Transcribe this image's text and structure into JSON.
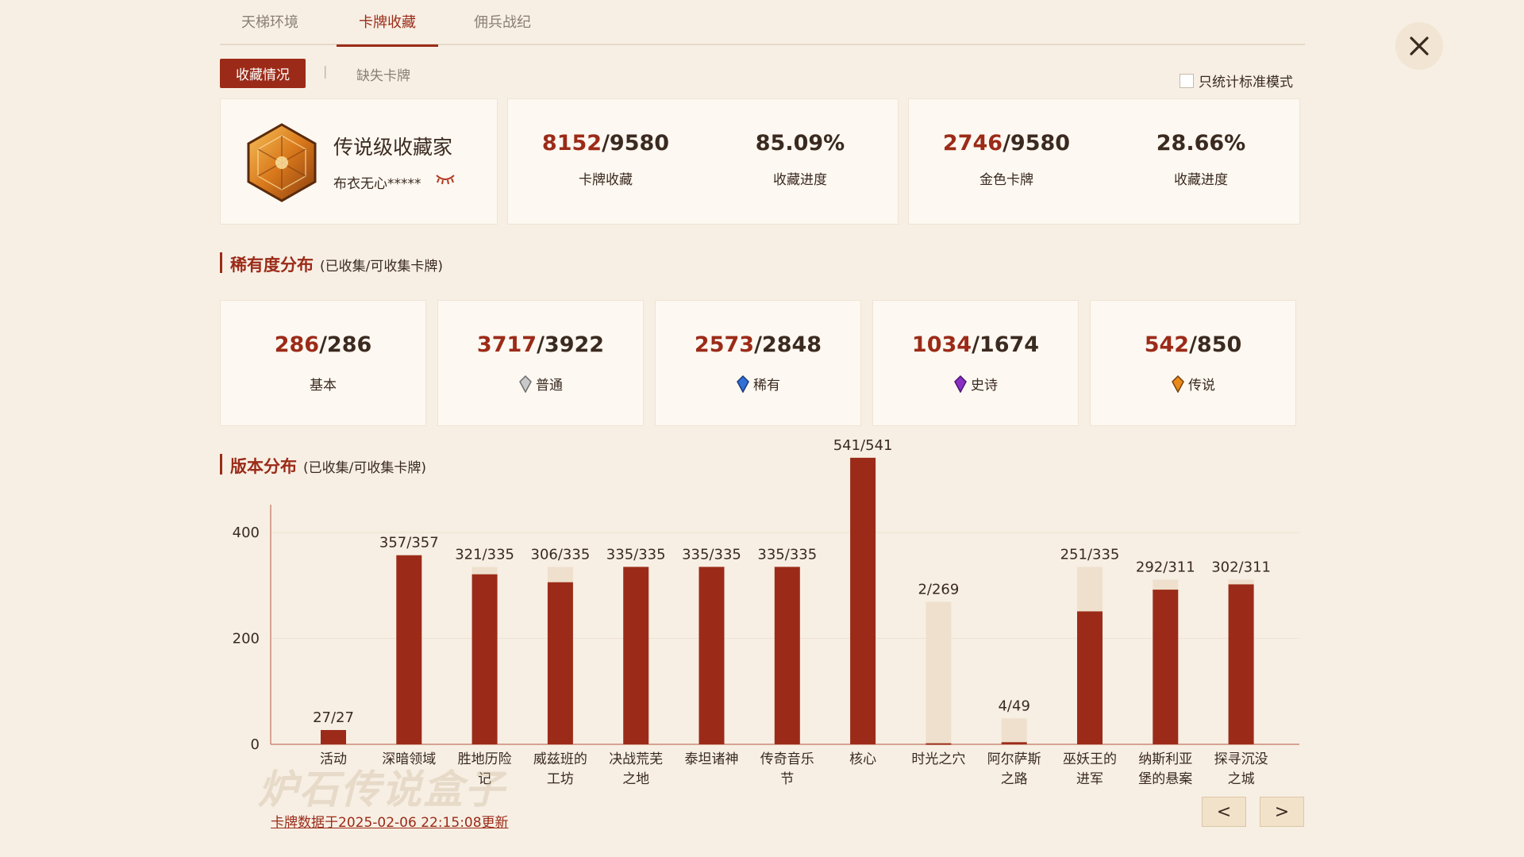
{
  "tabs": [
    {
      "label": "天梯环境",
      "active": false
    },
    {
      "label": "卡牌收藏",
      "active": true
    },
    {
      "label": "佣兵战纪",
      "active": false
    }
  ],
  "subtabs": {
    "active": "收藏情况",
    "separator": "|",
    "other": "缺失卡牌"
  },
  "std_filter": {
    "label": "只统计标准模式",
    "checked": false
  },
  "profile": {
    "title": "传说级收藏家",
    "user": "布衣无心*****",
    "icon": "hexagon-cardpack-icon"
  },
  "collection": {
    "cards": {
      "owned": "8152",
      "total": "/9580",
      "label": "卡牌收藏",
      "percent": "85.09%",
      "percent_label": "收藏进度"
    },
    "golden": {
      "owned": "2746",
      "total": "/9580",
      "label": "金色卡牌",
      "percent": "28.66%",
      "percent_label": "收藏进度"
    }
  },
  "rarity_section": {
    "title": "稀有度分布",
    "subtitle": "(已收集/可收集卡牌)"
  },
  "rarity": [
    {
      "owned": "286",
      "total": "/286",
      "label": "基本",
      "gem": ""
    },
    {
      "owned": "3717",
      "total": "/3922",
      "label": "普通",
      "gem": "#b8b8b8"
    },
    {
      "owned": "2573",
      "total": "/2848",
      "label": "稀有",
      "gem": "#2f6fd6"
    },
    {
      "owned": "1034",
      "total": "/1674",
      "label": "史诗",
      "gem": "#8a2fc4"
    },
    {
      "owned": "542",
      "total": "/850",
      "label": "传说",
      "gem": "#e88a1a"
    }
  ],
  "version_section": {
    "title": "版本分布",
    "subtitle": "(已收集/可收集卡牌)"
  },
  "chart_data": {
    "type": "bar",
    "categories": [
      [
        "活动"
      ],
      [
        "深暗领域"
      ],
      [
        "胜地历险",
        "记"
      ],
      [
        "威兹班的",
        "工坊"
      ],
      [
        "决战荒芜",
        "之地"
      ],
      [
        "泰坦诸神"
      ],
      [
        "传奇音乐",
        "节"
      ],
      [
        "核心"
      ],
      [
        "时光之穴"
      ],
      [
        "阿尔萨斯",
        "之路"
      ],
      [
        "巫妖王的",
        "进军"
      ],
      [
        "纳斯利亚",
        "堡的悬案"
      ],
      [
        "探寻沉没",
        "之城"
      ]
    ],
    "series": [
      {
        "name": "已收集",
        "values": [
          27,
          357,
          321,
          306,
          335,
          335,
          335,
          541,
          2,
          4,
          251,
          292,
          302
        ]
      },
      {
        "name": "可收集",
        "values": [
          27,
          357,
          335,
          335,
          335,
          335,
          335,
          541,
          269,
          49,
          335,
          311,
          311
        ]
      }
    ],
    "data_labels": [
      "27/27",
      "357/357",
      "321/335",
      "306/335",
      "335/335",
      "335/335",
      "335/335",
      "541/541",
      "2/269",
      "4/49",
      "251/335",
      "292/311",
      "302/311"
    ],
    "yticks": [
      0,
      200,
      400
    ],
    "ylim": [
      0,
      541
    ],
    "colors": {
      "owned": "#9b2b18",
      "total": "#eee0cc"
    }
  },
  "footer": {
    "update_text": "卡牌数据于2025-02-06 22:15:08更新",
    "watermark": "炉石传说盒子",
    "prev": "<",
    "next": ">"
  },
  "colors": {
    "accent": "#9b2b18",
    "background": "#f7efe4",
    "card": "#fdf8f1"
  }
}
